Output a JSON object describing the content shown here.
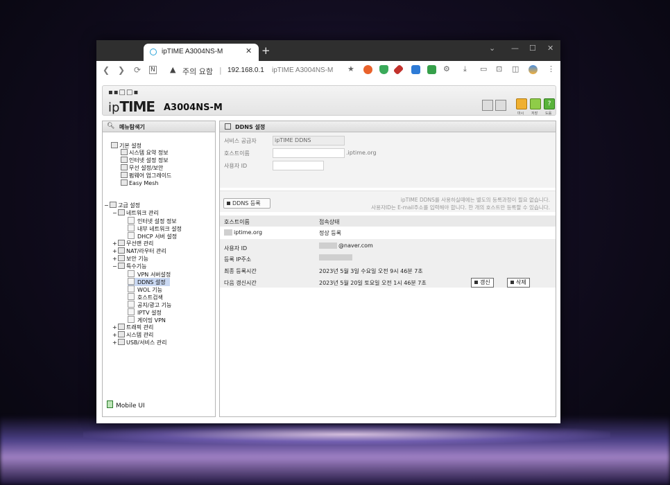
{
  "browser": {
    "tab_title": "ipTIME A3004NS-M",
    "tab_close": "✕",
    "new_tab": "+",
    "security_label": "주의 요함",
    "warning_icon": "▲",
    "url_host": "192.168.0.1",
    "url_title": "ipTIME A3004NS-M",
    "window_controls": [
      "⌄",
      "—",
      "☐",
      "✕"
    ]
  },
  "header": {
    "logo_text": "ipTIME",
    "model": "A3004NS-M",
    "labels": [
      "마시",
      "저장",
      "도움"
    ]
  },
  "sidebar": {
    "title": "메뉴탐색기",
    "basic": {
      "label": "기본 설정",
      "items": [
        "시스템 요약 정보",
        "인터넷 설정 정보",
        "무선 설정/보안",
        "펌웨어 업그레이드",
        "Easy Mesh"
      ]
    },
    "advanced": {
      "label": "고급 설정",
      "network": {
        "label": "네트워크 관리",
        "items": [
          "인터넷 설정 정보",
          "내부 네트워크 설정",
          "DHCP 서버 설정"
        ]
      },
      "groups_mid": [
        "무선랜 관리",
        "NAT/라우터 관리",
        "보안 기능"
      ],
      "special": {
        "label": "특수기능",
        "items": [
          "VPN 서버설정",
          "DDNS 설정",
          "WOL 기능",
          "호스트검색",
          "공지/광고 기능",
          "IPTV 설정",
          "게이밍 VPN"
        ],
        "selected": "DDNS 설정"
      },
      "groups_end": [
        "트래픽 관리",
        "시스템 관리",
        "USB/서비스 관리"
      ]
    },
    "mobile_ui": "Mobile UI"
  },
  "ddns": {
    "title": "DDNS 설정",
    "form": {
      "provider_label": "서비스 공급자",
      "provider_value": "ipTIME DDNS",
      "host_label": "호스트이름",
      "host_value": "",
      "host_suffix": ".iptime.org",
      "user_label": "사용자 ID",
      "user_value": ""
    },
    "register_button": "DDNS 등록",
    "notice_line1": "ipTIME DDNS를 사용하실때에는 별도의 등록과정이 필요 없습니다.",
    "notice_line2": "사용자ID는 E-mail주소를 입력해야 합니다. 한 개의 호스트만 등록할 수 있습니다.",
    "table": {
      "headers": [
        "호스트이름",
        "접속상태"
      ],
      "row": {
        "host": "iptime.org",
        "status": "정상 등록"
      }
    },
    "info": {
      "user_label": "사용자 ID",
      "user_value": "@naver.com",
      "ip_label": "등록 IP주소",
      "last_label": "최종 등록시간",
      "last_value": "2023년 5월 3일 수요일 오전 9시 46분 7초",
      "next_label": "다음 갱신시간",
      "next_value": "2023년 5월 20일 토요일 오전 1시 46분 7초",
      "renew_button": "갱신",
      "delete_button": "삭제"
    }
  }
}
